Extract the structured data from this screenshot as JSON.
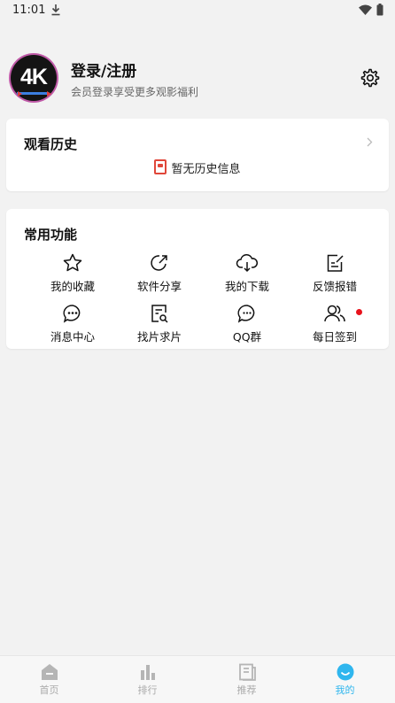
{
  "status": {
    "time": "11:01"
  },
  "profile": {
    "avatar_text": "4K",
    "title": "登录/注册",
    "subtitle": "会员登录享受更多观影福利"
  },
  "history": {
    "title": "观看历史",
    "empty": "暂无历史信息"
  },
  "functions": {
    "title": "常用功能",
    "items": [
      {
        "label": "我的收藏",
        "icon": "star-icon"
      },
      {
        "label": "软件分享",
        "icon": "share-icon"
      },
      {
        "label": "我的下载",
        "icon": "cloud-download-icon"
      },
      {
        "label": "反馈报错",
        "icon": "feedback-edit-icon"
      },
      {
        "label": "消息中心",
        "icon": "message-icon"
      },
      {
        "label": "找片求片",
        "icon": "search-document-icon"
      },
      {
        "label": "QQ群",
        "icon": "chat-bubble-icon"
      },
      {
        "label": "每日签到",
        "icon": "users-icon"
      }
    ],
    "badge_color": "#e8121c"
  },
  "tabs": [
    {
      "label": "首页",
      "icon": "home-icon"
    },
    {
      "label": "排行",
      "icon": "chart-bars-icon"
    },
    {
      "label": "推荐",
      "icon": "book-icon"
    },
    {
      "label": "我的",
      "icon": "smile-icon",
      "active": true
    }
  ],
  "colors": {
    "accent": "#2fb6ee",
    "inactive_tab": "#aaaaaa"
  }
}
